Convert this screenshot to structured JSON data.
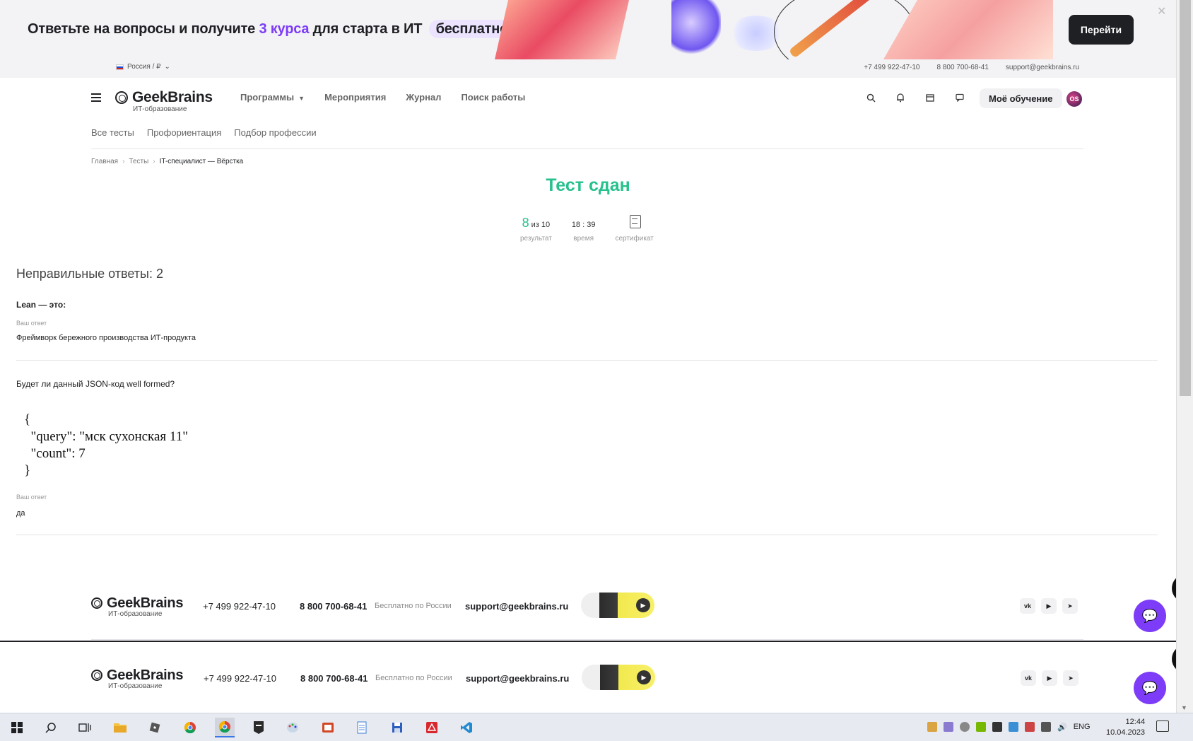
{
  "promo": {
    "text_before": "Ответьте на вопросы и получите ",
    "text_accent": "3 курса",
    "text_after": " для старта в ИТ ",
    "text_pill": "бесплатно",
    "button": "Перейти",
    "close": "✕"
  },
  "topbar": {
    "region": "Россия / ₽",
    "phone1": "+7 499 922-47-10",
    "phone2": "8 800 700-68-41",
    "email": "support@geekbrains.ru"
  },
  "header": {
    "logo_name": "GeekBrains",
    "logo_sub": "ИТ-образование",
    "nav": [
      "Программы",
      "Мероприятия",
      "Журнал",
      "Поиск работы"
    ],
    "my_learning": "Моё обучение",
    "avatar": "OS",
    "subnav": [
      "Все тесты",
      "Профориентация",
      "Подбор профессии"
    ]
  },
  "breadcrumb": {
    "home": "Главная",
    "tests": "Тесты",
    "current": "IT-специалист — Вёрстка"
  },
  "result": {
    "title": "Тест сдан",
    "score": "8",
    "score_of": "из 10",
    "score_label": "результат",
    "time": "18 : 39",
    "time_label": "время",
    "cert_label": "сертификат"
  },
  "wrong": {
    "title": "Неправильные ответы: 2",
    "questions": [
      {
        "question": "Lean — это:",
        "answer_label": "Ваш ответ",
        "answer": "Фреймворк бережного производства ИТ-продукта"
      },
      {
        "question": "Будет ли данный JSON-код well formed?",
        "code": "{\n  \"query\": \"мск сухонская 11\"\n  \"count\": 7\n}",
        "answer_label": "Ваш ответ",
        "answer": "да"
      }
    ]
  },
  "footer": {
    "logo_name": "GeekBrains",
    "logo_sub": "ИТ-образование",
    "phone1": "+7 499 922-47-10",
    "phone2": "8 800 700-68-41",
    "free": "Бесплатно по России",
    "email": "support@geekbrains.ru",
    "socials": [
      "vk",
      "▶",
      "➤"
    ]
  },
  "taskbar": {
    "lang": "ENG",
    "time": "12:44",
    "date": "10.04.2023"
  }
}
